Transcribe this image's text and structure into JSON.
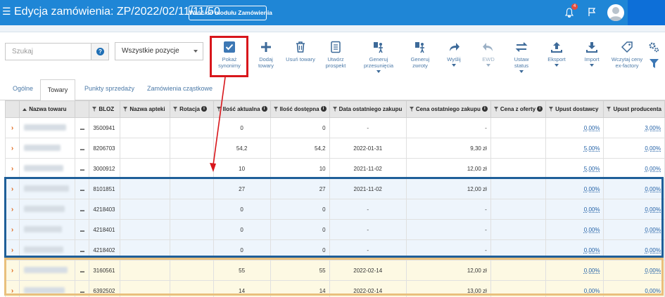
{
  "header": {
    "title": "Edycja zamówienia: ZP/2022/02/11/11/50",
    "back_button": "Wróć do modułu Zamówienia",
    "notification_count": "4",
    "colors": {
      "bar": "#1f86d6",
      "account": "#0d6fd8"
    }
  },
  "filters": {
    "search_placeholder": "Szukaj",
    "help_label": "?",
    "select_value": "Wszystkie pozycje"
  },
  "toolbar": [
    {
      "icon": "checkmark-icon",
      "line1": "Pokaż",
      "line2": "synonimy"
    },
    {
      "icon": "plus-icon",
      "line1": "Dodaj",
      "line2": "towary"
    },
    {
      "icon": "trash-icon",
      "line1": "Usuń towary",
      "line2": ""
    },
    {
      "icon": "document-icon",
      "line1": "Utwórz",
      "line2": "prospekt"
    },
    {
      "icon": "transfer-icon",
      "line1": "Generuj",
      "line2": "przesunięcia"
    },
    {
      "icon": "return-icon",
      "line1": "Generuj",
      "line2": "zwroty"
    },
    {
      "icon": "send-arrow-icon",
      "line1": "Wyślij",
      "line2": ""
    },
    {
      "icon": "undo-arrow-icon",
      "line1": "EWD",
      "line2": ""
    },
    {
      "icon": "status-arrows-icon",
      "line1": "Ustaw",
      "line2": "status"
    },
    {
      "icon": "upload-icon",
      "line1": "Eksport",
      "line2": ""
    },
    {
      "icon": "download-icon",
      "line1": "Import",
      "line2": ""
    },
    {
      "icon": "tag-icon",
      "line1": "Wczytaj ceny",
      "line2": "ex-factory"
    }
  ],
  "tabs": [
    "Ogólne",
    "Towary",
    "Punkty sprzedaży",
    "Zamówienia cząstkowe"
  ],
  "active_tab": "Towary",
  "table": {
    "columns": [
      "Nazwa towaru",
      "BLOZ",
      "Nazwa apteki",
      "Rotacja",
      "Ilość aktualna",
      "Ilość dostępna",
      "Data ostatniego zakupu",
      "Cena ostatniego zakupu",
      "Cena z oferty",
      "Upust dostawcy",
      "Upust producenta"
    ],
    "dots_label": "...",
    "rows": [
      {
        "bloz": "3500941",
        "apteka": "",
        "rotacja": "",
        "akt": "0",
        "dost": "0",
        "data": "-",
        "cena": "-",
        "oferta": "",
        "upust_d": "0,00%",
        "upust_p": "3,00%",
        "group": ""
      },
      {
        "bloz": "8206703",
        "apteka": "",
        "rotacja": "",
        "akt": "54,2",
        "dost": "54,2",
        "data": "2022-01-31",
        "cena": "9,30 zł",
        "oferta": "",
        "upust_d": "5,00%",
        "upust_p": "0,00%",
        "group": ""
      },
      {
        "bloz": "3000912",
        "apteka": "",
        "rotacja": "",
        "akt": "10",
        "dost": "10",
        "data": "2021-11-02",
        "cena": "12,00 zł",
        "oferta": "",
        "upust_d": "5,00%",
        "upust_p": "0,00%",
        "group": ""
      },
      {
        "bloz": "8101851",
        "apteka": "",
        "rotacja": "",
        "akt": "27",
        "dost": "27",
        "data": "2021-11-02",
        "cena": "12,00 zł",
        "oferta": "",
        "upust_d": "0,00%",
        "upust_p": "0,00%",
        "group": "blue"
      },
      {
        "bloz": "4218403",
        "apteka": "",
        "rotacja": "",
        "akt": "0",
        "dost": "0",
        "data": "-",
        "cena": "-",
        "oferta": "",
        "upust_d": "0,00%",
        "upust_p": "0,00%",
        "group": "blue"
      },
      {
        "bloz": "4218401",
        "apteka": "",
        "rotacja": "",
        "akt": "0",
        "dost": "0",
        "data": "-",
        "cena": "-",
        "oferta": "",
        "upust_d": "0,00%",
        "upust_p": "0,00%",
        "group": "blue"
      },
      {
        "bloz": "4218402",
        "apteka": "",
        "rotacja": "",
        "akt": "0",
        "dost": "0",
        "data": "-",
        "cena": "-",
        "oferta": "",
        "upust_d": "0,00%",
        "upust_p": "0,00%",
        "group": "blue"
      },
      {
        "bloz": "3160561",
        "apteka": "",
        "rotacja": "",
        "akt": "55",
        "dost": "55",
        "data": "2022-02-14",
        "cena": "12,00 zł",
        "oferta": "",
        "upust_d": "0,00%",
        "upust_p": "0,00%",
        "group": "yellow"
      },
      {
        "bloz": "6392502",
        "apteka": "",
        "rotacja": "",
        "akt": "14",
        "dost": "14",
        "data": "2022-02-14",
        "cena": "13,00 zł",
        "oferta": "",
        "upust_d": "0,00%",
        "upust_p": "0,00%",
        "group": "yellow"
      }
    ]
  },
  "annotations": {
    "highlight_color": "#d8161b",
    "group1_color": "#1f5f99",
    "group2_color": "#e9c07d"
  }
}
